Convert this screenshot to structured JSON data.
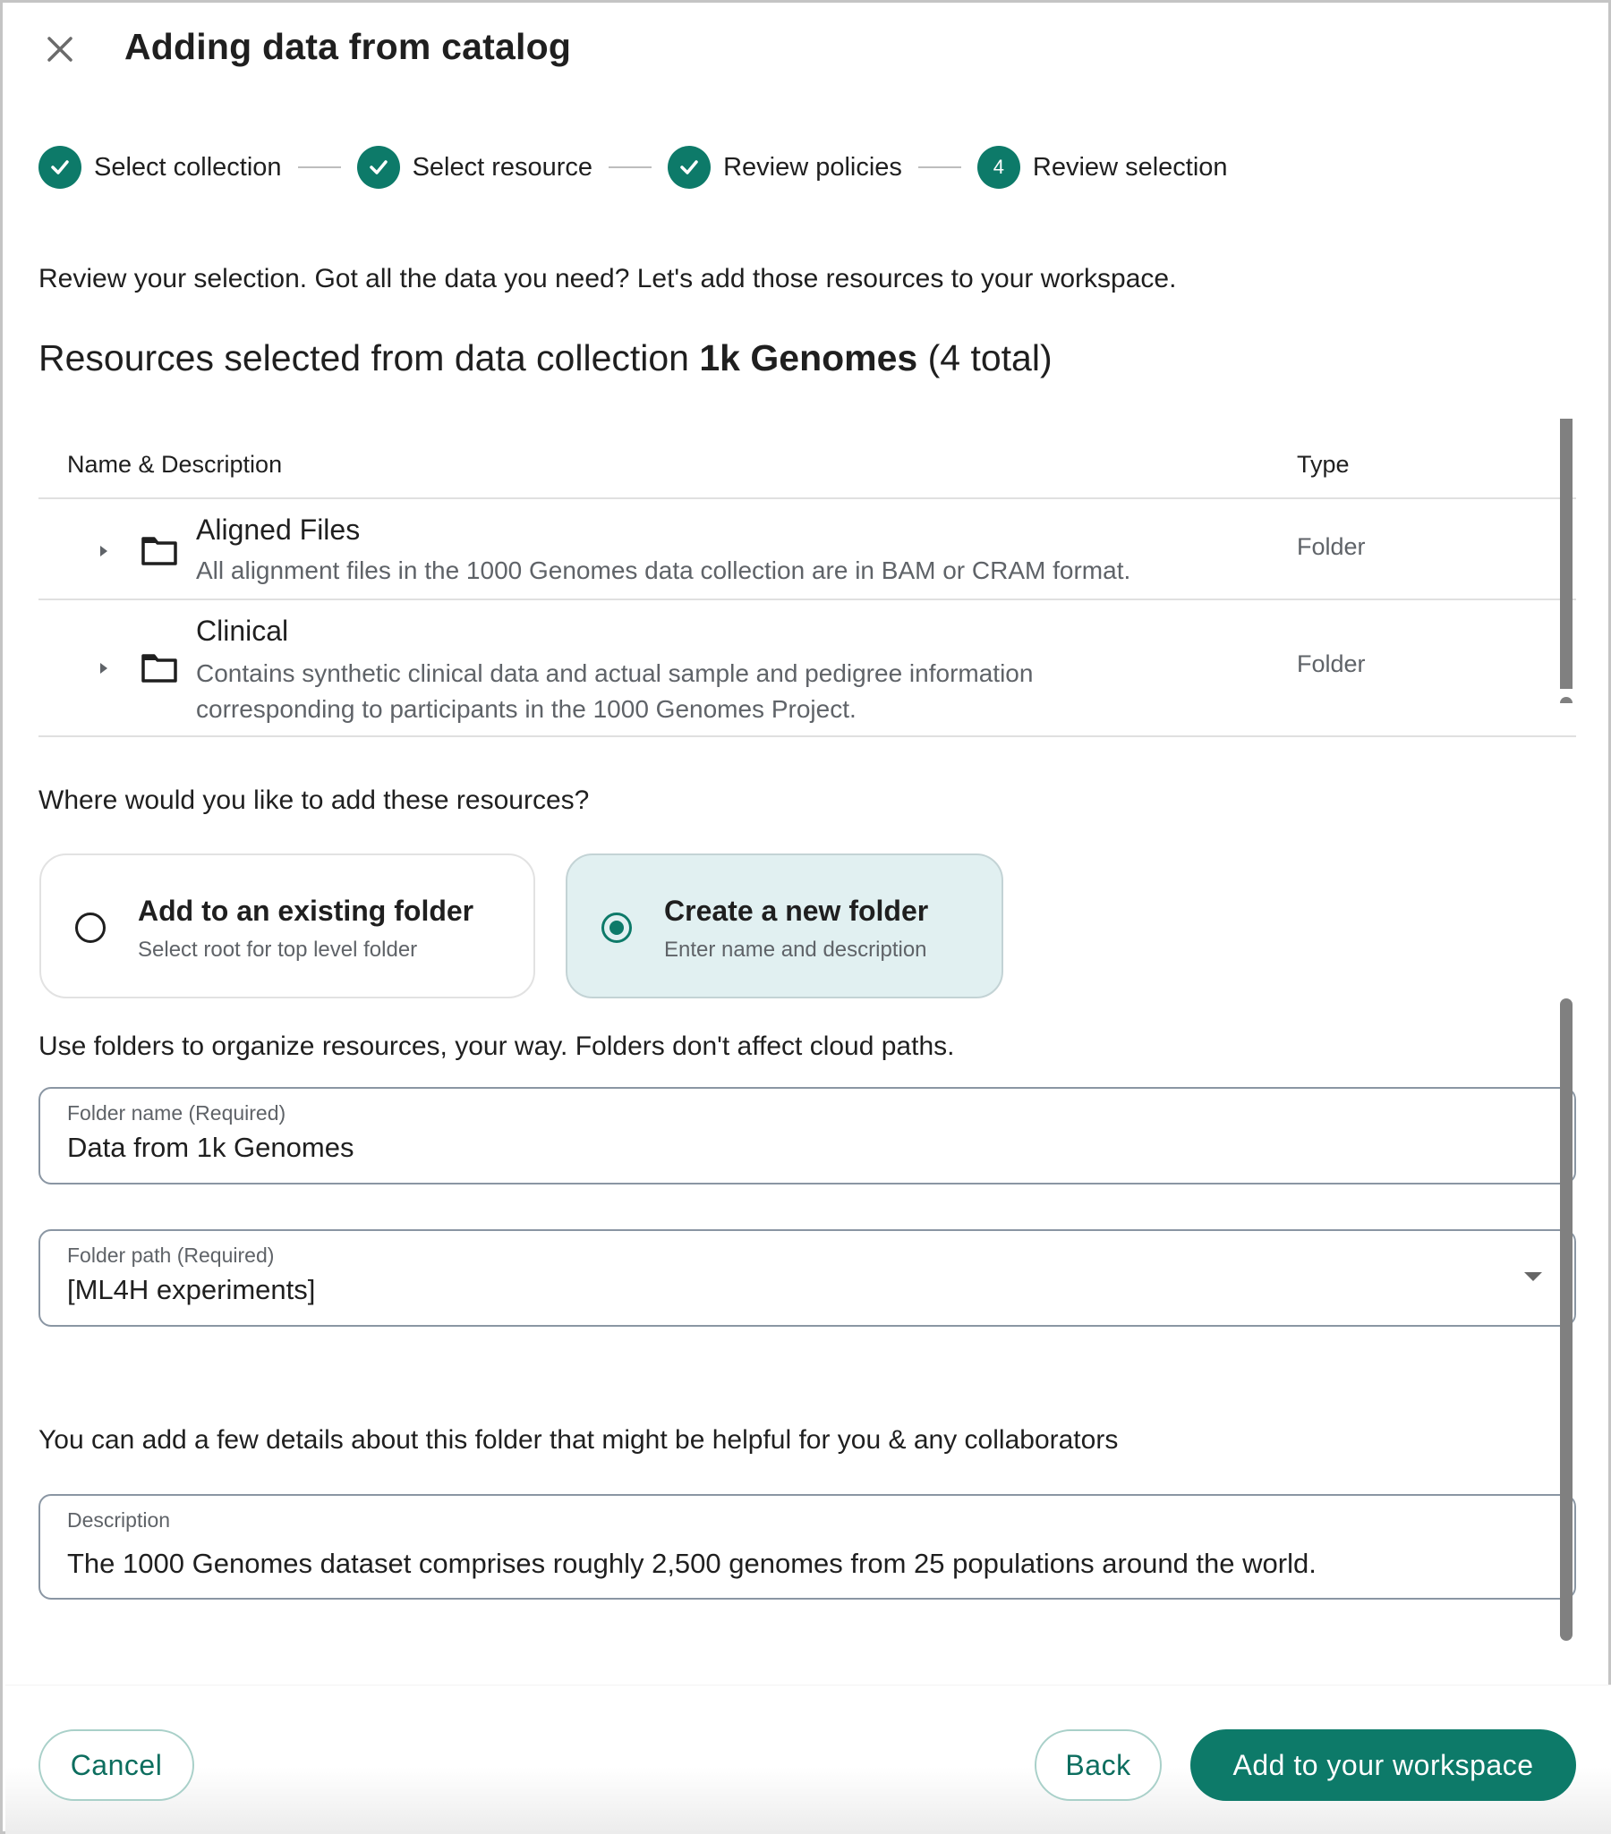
{
  "dialog": {
    "title": "Adding data from catalog",
    "close_icon": "close-icon"
  },
  "stepper": {
    "steps": [
      {
        "label": "Select collection",
        "state": "complete",
        "icon": "check-icon"
      },
      {
        "label": "Select resource",
        "state": "complete",
        "icon": "check-icon"
      },
      {
        "label": "Review policies",
        "state": "complete",
        "icon": "check-icon"
      },
      {
        "label": "Review selection",
        "state": "current",
        "number": "4"
      }
    ]
  },
  "intro_text": "Review your selection. Got all the data you need? Let's add those resources to your workspace.",
  "resources": {
    "heading_prefix": "Resources selected from data collection ",
    "collection_name": "1k Genomes",
    "heading_suffix": " (4 total)",
    "columns": [
      "Name & Description",
      "Type"
    ],
    "rows": [
      {
        "name": "Aligned Files",
        "description": "All alignment files in the 1000 Genomes data collection are in BAM or CRAM format.",
        "type": "Folder",
        "icon": "folder-icon"
      },
      {
        "name": "Clinical",
        "description": "Contains synthetic clinical data and actual sample and pedigree information corresponding to participants in the 1000 Genomes Project.",
        "type": "Folder",
        "icon": "folder-icon"
      }
    ]
  },
  "destination": {
    "question": "Where would you like to add these resources?",
    "options": [
      {
        "title": "Add to an existing folder",
        "subtitle": "Select root for top level folder",
        "selected": false
      },
      {
        "title": "Create a new folder",
        "subtitle": "Enter name and description",
        "selected": true
      }
    ]
  },
  "folders_note": "Use folders to organize resources, your way. Folders don't affect cloud paths.",
  "form": {
    "folder_name": {
      "label": "Folder name (Required)",
      "value": "Data from 1k Genomes"
    },
    "folder_path": {
      "label": "Folder path (Required)",
      "value": "[ML4H experiments]"
    },
    "details_note": "You can add a few details about this folder that might be helpful for you & any collaborators",
    "description": {
      "label": "Description",
      "value": "The 1000 Genomes dataset comprises roughly 2,500 genomes from 25 populations around the world."
    }
  },
  "footer": {
    "cancel_label": "Cancel",
    "back_label": "Back",
    "submit_label": "Add to your workspace"
  },
  "colors": {
    "accent": "#0d7a69",
    "selected_card_bg": "#e1f0f1",
    "outline_button_border": "#a9d0c9"
  }
}
